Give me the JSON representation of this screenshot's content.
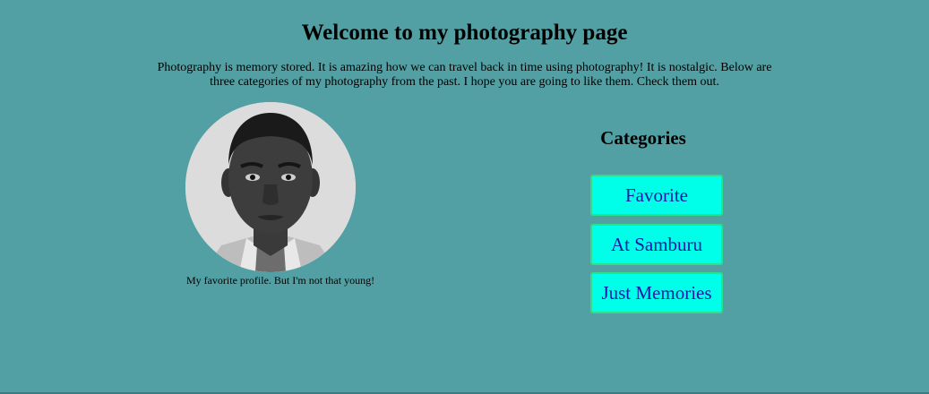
{
  "header": {
    "title": "Welcome to my photography page",
    "intro": "Photography is memory stored. It is amazing how we can travel back in time using photography! It is nostalgic. Below are three categories of my photography from the past. I hope you are going to like them. Check them out."
  },
  "profile": {
    "caption": "My favorite profile. But I'm not that young!"
  },
  "categories": {
    "heading": "Categories",
    "buttons": [
      {
        "label": "Favorite"
      },
      {
        "label": "At Samburu"
      },
      {
        "label": "Just Memories"
      }
    ]
  },
  "colors": {
    "page_background": "#52a0a4",
    "button_background": "#00ffe8",
    "button_border": "#2be08a",
    "button_text": "#1a1aa6"
  }
}
